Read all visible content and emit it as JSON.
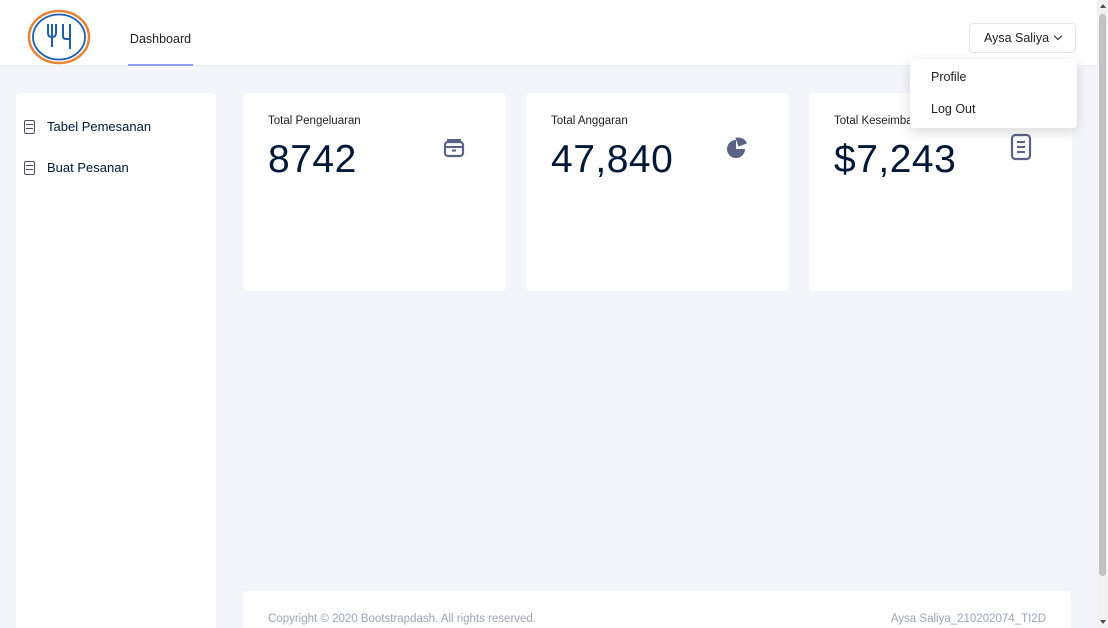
{
  "header": {
    "nav_dashboard": "Dashboard",
    "user_name": "Aysa Saliya",
    "logo_icon": "fork-and-knife-logo-icon"
  },
  "user_menu": {
    "items": [
      {
        "label": "Profile"
      },
      {
        "label": "Log Out"
      }
    ]
  },
  "sidebar": {
    "items": [
      {
        "label": "Tabel Pemesanan",
        "icon": "clipboard-icon"
      },
      {
        "label": "Buat Pesanan",
        "icon": "clipboard-icon"
      }
    ]
  },
  "cards": [
    {
      "label": "Total Pengeluaran",
      "value": "8742",
      "icon": "wallet-icon"
    },
    {
      "label": "Total Anggaran",
      "value": "47,840",
      "icon": "pie-chart-icon"
    },
    {
      "label": "Total Keseimbangan",
      "value": "$7,243",
      "icon": "clipboard-list-icon"
    }
  ],
  "footer": {
    "copyright": "Copyright © 2020 Bootstrapdash. All rights reserved.",
    "credit": "Aysa Saliya_210202074_TI2D"
  },
  "colors": {
    "accent": "#8e9dff",
    "logo_ring": "#e8833a",
    "icon": "#5b6182",
    "text_dark": "#001737",
    "background": "#f4f5fa"
  }
}
